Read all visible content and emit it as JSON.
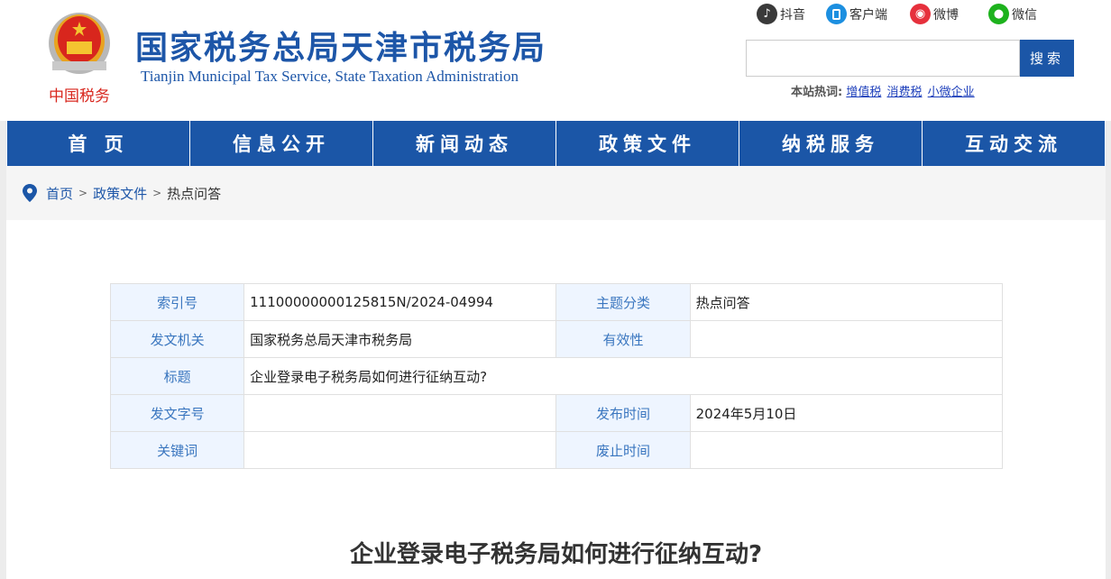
{
  "header": {
    "title": "国家税务总局天津市税务局",
    "subtitle": "Tianjin Municipal Tax Service, State Taxation Administration",
    "emblem_caption": "中国税务",
    "social": [
      {
        "label": "抖音",
        "icon": "tiktok-icon",
        "color": "#3a3a3a"
      },
      {
        "label": "客户端",
        "icon": "mobile-app-icon",
        "color": "#1c8fe0"
      },
      {
        "label": "微博",
        "icon": "weibo-icon",
        "color": "#e6303c"
      },
      {
        "label": "微信",
        "icon": "wechat-icon",
        "color": "#1db21d"
      }
    ],
    "search": {
      "value": "",
      "placeholder": "",
      "button_label": "搜索"
    },
    "hot_words_label": "本站热词:",
    "hot_words": [
      "增值税",
      "消费税",
      "小微企业"
    ]
  },
  "nav": [
    "首 页",
    "信息公开",
    "新闻动态",
    "政策文件",
    "纳税服务",
    "互动交流"
  ],
  "breadcrumb": {
    "items": [
      "首页",
      "政策文件"
    ],
    "current": "热点问答",
    "separator": ">"
  },
  "meta": {
    "rows": [
      {
        "k1": "索引号",
        "v1": "11100000000125815N/2024-04994",
        "k2": "主题分类",
        "v2": "热点问答"
      },
      {
        "k1": "发文机关",
        "v1": "国家税务总局天津市税务局",
        "k2": "有效性",
        "v2": ""
      },
      {
        "k1": "标题",
        "v1": "企业登录电子税务局如何进行征纳互动?"
      },
      {
        "k1": "发文字号",
        "v1": "",
        "k2": "发布时间",
        "v2": "2024年5月10日"
      },
      {
        "k1": "关键词",
        "v1": "",
        "k2": "废止时间",
        "v2": ""
      }
    ]
  },
  "article": {
    "title": "企业登录电子税务局如何进行征纳互动?"
  },
  "colors": {
    "brand_blue": "#1b56a7",
    "label_bg": "#eef5ff",
    "label_text": "#3a76bf"
  }
}
